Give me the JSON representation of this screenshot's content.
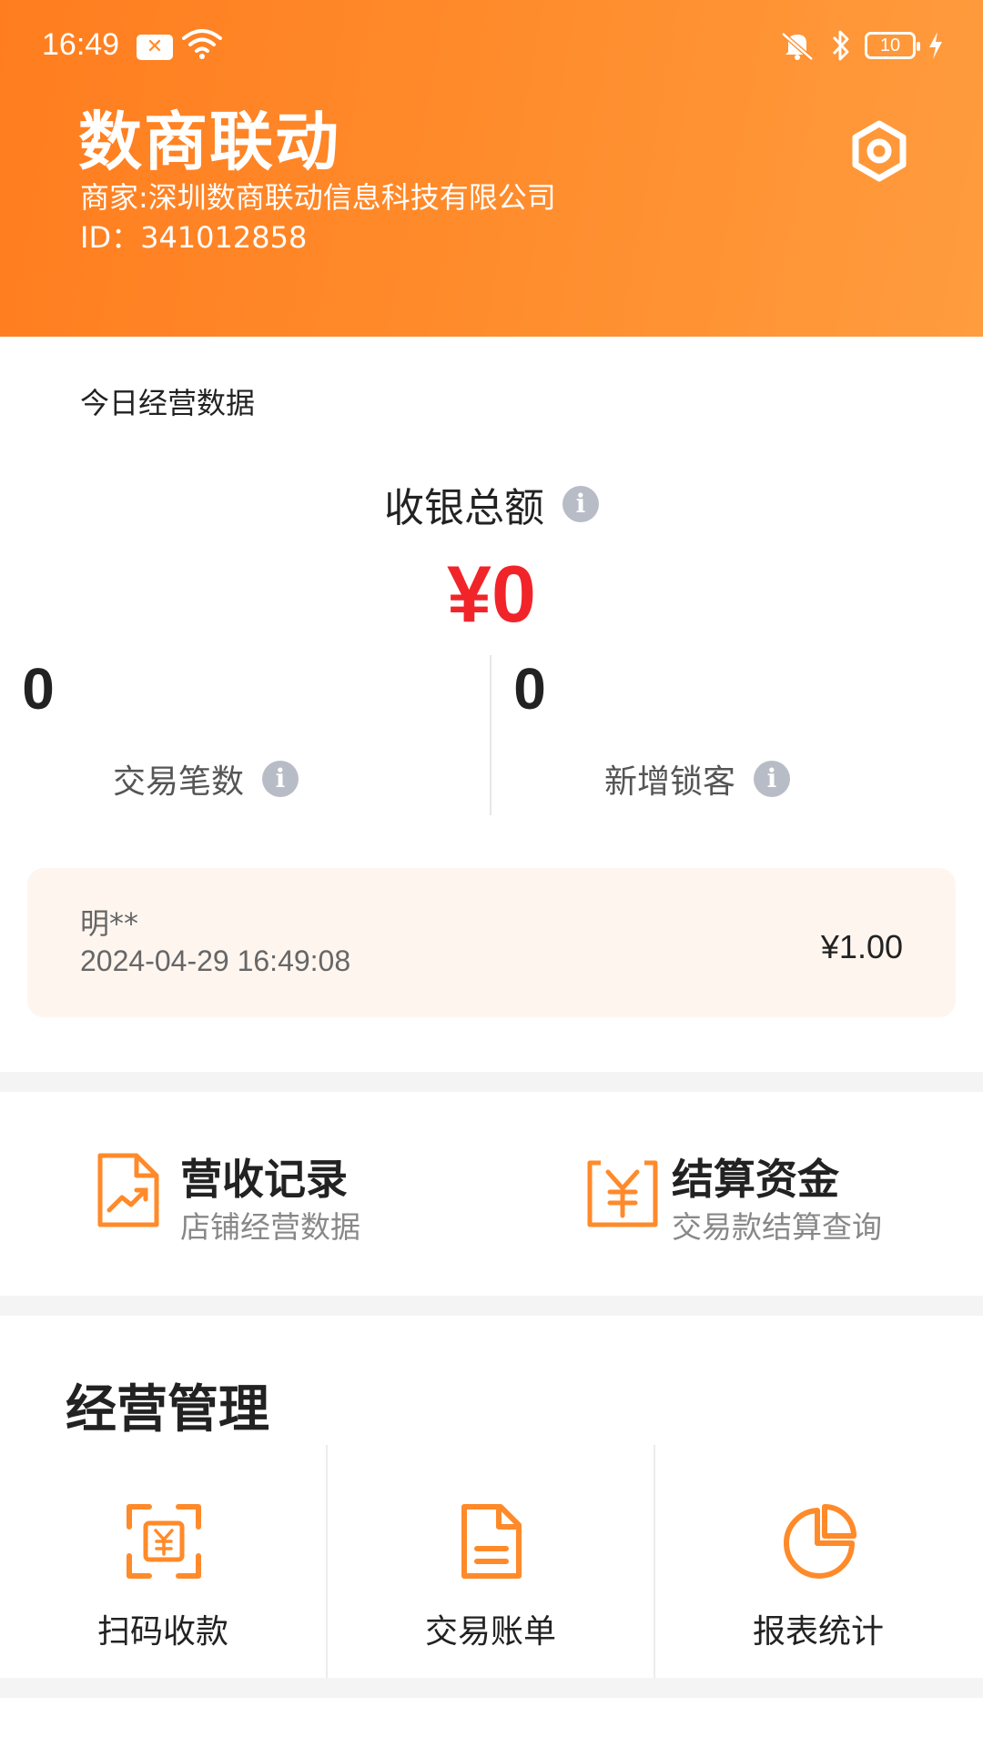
{
  "status_bar": {
    "time": "16:49",
    "battery": "10"
  },
  "header": {
    "title": "数商联动",
    "merchant": "商家:深圳数商联动信息科技有限公司",
    "merchant_id": "ID：341012858"
  },
  "today": {
    "section_label": "今日经营数据",
    "total_label": "收银总额",
    "total_value": "¥0",
    "transactions_value": "0",
    "transactions_label": "交易笔数",
    "new_customers_value": "0",
    "new_customers_label": "新增锁客",
    "latest_transaction": {
      "name": "明**",
      "time": "2024-04-29 16:49:08",
      "amount": "¥1.00"
    }
  },
  "shortcuts": [
    {
      "title": "营收记录",
      "subtitle": "店铺经营数据"
    },
    {
      "title": "结算资金",
      "subtitle": "交易款结算查询"
    }
  ],
  "management": {
    "title": "经营管理",
    "items": [
      {
        "label": "扫码收款"
      },
      {
        "label": "交易账单"
      },
      {
        "label": "报表统计"
      }
    ]
  },
  "colors": {
    "brand_orange": "#ff8a2a",
    "amount_red": "#f1242a",
    "card_bg": "#fff5ef"
  }
}
